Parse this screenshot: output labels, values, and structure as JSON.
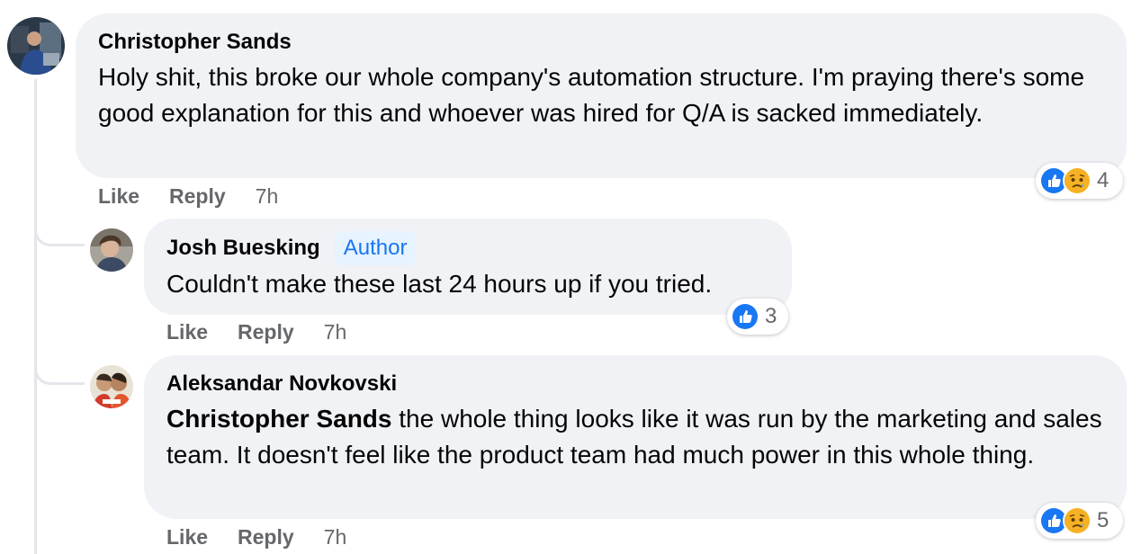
{
  "comments": [
    {
      "author": "Christopher Sands",
      "text": "Holy shit, this broke our whole company's automation structure. I'm praying there's some good explanation for this and whoever was hired for Q/A is sacked immediately.",
      "like_label": "Like",
      "reply_label": "Reply",
      "time": "7h",
      "reactions": {
        "icons": [
          "like-icon",
          "sad-icon"
        ],
        "count": "4"
      }
    },
    {
      "author": "Josh Buesking",
      "badge": "Author",
      "text": "Couldn't make these last 24 hours up if you tried.",
      "like_label": "Like",
      "reply_label": "Reply",
      "time": "7h",
      "reactions": {
        "icons": [
          "like-icon"
        ],
        "count": "3"
      }
    },
    {
      "author": "Aleksandar Novkovski",
      "mention": "Christopher Sands",
      "text": " the whole thing looks like it was run by the marketing and sales team. It doesn't feel like the product team had much power in this whole thing.",
      "like_label": "Like",
      "reply_label": "Reply",
      "time": "7h",
      "reactions": {
        "icons": [
          "like-icon",
          "sad-icon"
        ],
        "count": "5"
      }
    }
  ],
  "colors": {
    "bubble": "#f0f2f5",
    "secondary_text": "#65676b",
    "like_blue": "#1877f2",
    "sad_yellow": "#f7b125",
    "badge_bg": "#e7f3ff"
  }
}
